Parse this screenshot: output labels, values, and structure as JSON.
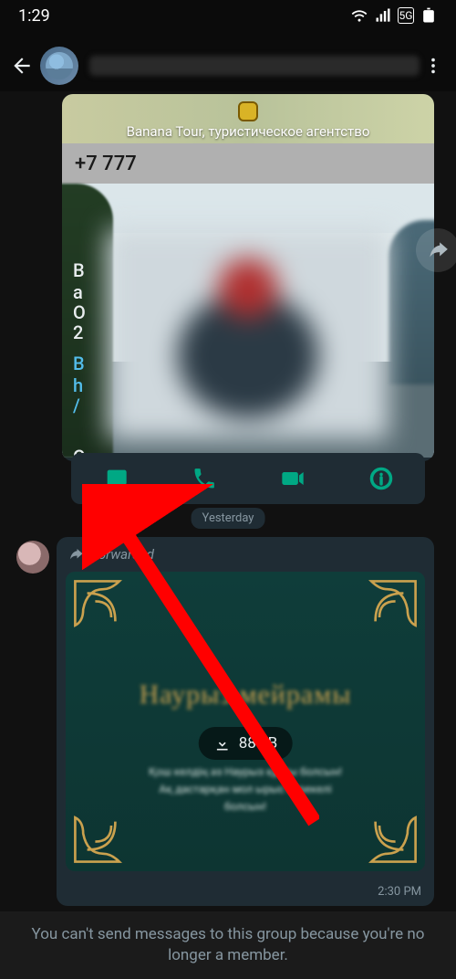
{
  "status": {
    "time": "1:29"
  },
  "contact_card": {
    "place_name": "Banana Tour, туристическое агентство",
    "phone": "+7 777"
  },
  "date_separator": "Yesterday",
  "forwarded": {
    "label": "Forwarded",
    "download_size": "88 kB",
    "time": "2:30 PM"
  },
  "notice": "You can't send messages to this group because you're no longer a member.",
  "letters": {
    "b": "B",
    "a": "a",
    "o": "O",
    "two": "2",
    "b2": "B",
    "h": "h",
    "slash": "/",
    "c": "C"
  }
}
